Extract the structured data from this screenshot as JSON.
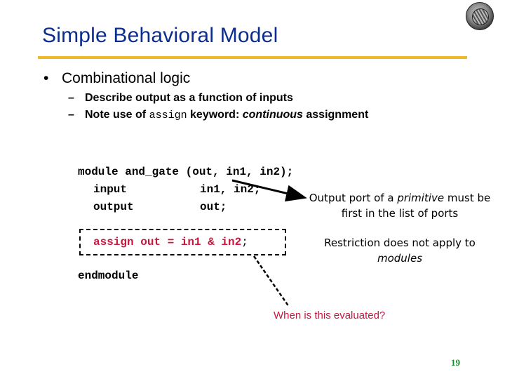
{
  "slide": {
    "title": "Simple Behavioral Model",
    "page_number": "19",
    "accent_color": "#efba27",
    "title_color": "#0b2d8f"
  },
  "bullets": {
    "main": {
      "marker": "•",
      "text": "Combinational logic"
    },
    "sub": [
      {
        "marker": "–",
        "text": "Describe output as a function of inputs"
      },
      {
        "marker": "–",
        "prefix": "Note use of ",
        "code": "assign",
        "middle": " keyword: ",
        "emphasis": "continuous",
        "suffix": " assignment"
      }
    ]
  },
  "code": {
    "line1": "module and_gate (out, in1, in2);",
    "line2_kw": "input",
    "line2_args": "in1, in2;",
    "line3_kw": "output",
    "line3_args": "out;",
    "assign_stmt": "assign out = in1 & in2",
    "assign_semi": ";",
    "end": "endmodule"
  },
  "annotations": {
    "note1_a": "Output port of a ",
    "note1_em": "primitive",
    "note1_b": " must be first in the list of ports",
    "note2_a": "Restriction does not apply to ",
    "note2_em": "modules",
    "question": "When is this evaluated?",
    "question_color": "#c8173f"
  },
  "logo": {
    "icon": "university-seal-icon"
  }
}
